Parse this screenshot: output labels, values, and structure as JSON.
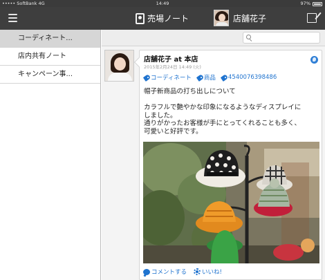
{
  "status_bar": {
    "carrier": "••••• SoftBank  4G",
    "time": "14:49",
    "battery_percent": "97%"
  },
  "nav": {
    "menu_icon": "hamburger-icon",
    "title": "売場ノート",
    "title_icon": "notebook-icon",
    "user_name": "店舗花子",
    "compose_icon": "compose-icon"
  },
  "sidebar": {
    "items": [
      {
        "label": "コーディネート...",
        "active": true
      },
      {
        "label": "店内共有ノート",
        "active": false
      },
      {
        "label": "キャンペーン事...",
        "active": false
      }
    ]
  },
  "search": {
    "placeholder": ""
  },
  "post": {
    "author": "店舗花子",
    "at_label": "at",
    "store": "本店",
    "date": "2015年2月24日 14:49 (火)",
    "tags": [
      "コーディネート",
      "商品",
      "4540076398486"
    ],
    "lines": [
      "帽子新商品の打ち出しについて",
      "",
      "カラフルで艶やかな印象になるようなディスプレイに",
      "しました。",
      "通りがかったお客様が手にとってくれることも多く、",
      "可愛いと好評です。"
    ],
    "comment_label": "コメントする",
    "like_label": "いいね!"
  },
  "colors": {
    "nav_bg": "#3e3e3e",
    "link_blue": "#1f73cf",
    "sidebar_active": "#d6d6d6"
  }
}
